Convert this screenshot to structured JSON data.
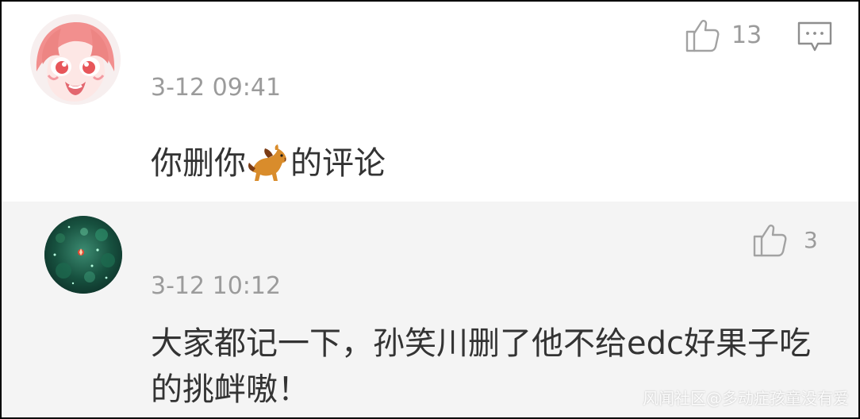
{
  "comments": [
    {
      "timestamp": "3-12 09:41",
      "text_before_emoji": "你删你",
      "emoji": "horse-emoji",
      "text_after_emoji": "的评论",
      "likes": "13"
    },
    {
      "timestamp": "3-12 10:12",
      "text": "大家都记一下，孙笑川删了他不给edc好果子吃的挑衅嗷！",
      "likes": "3"
    }
  ],
  "watermark": "风闻社区@多动症孩童没有爱",
  "colors": {
    "reply_background": "#f4f4f4",
    "meta_text": "#9b9b9b",
    "body_text": "#333333"
  }
}
